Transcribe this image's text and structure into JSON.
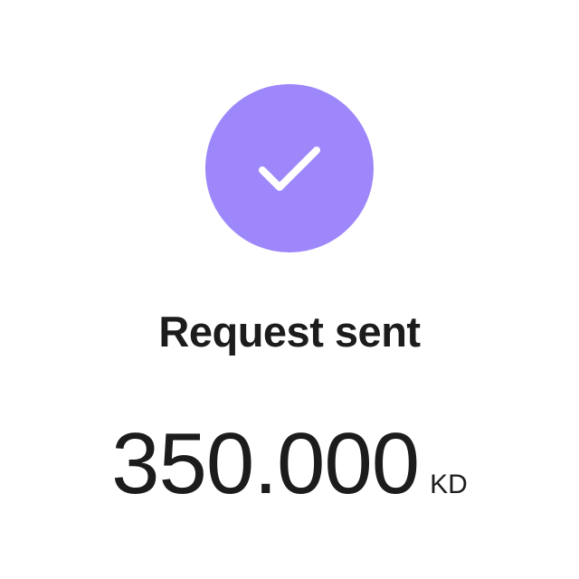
{
  "status": {
    "icon": "checkmark-icon",
    "accent_color": "#9d87fb",
    "title": "Request sent"
  },
  "amount": {
    "value": "350.000",
    "currency": "KD"
  }
}
